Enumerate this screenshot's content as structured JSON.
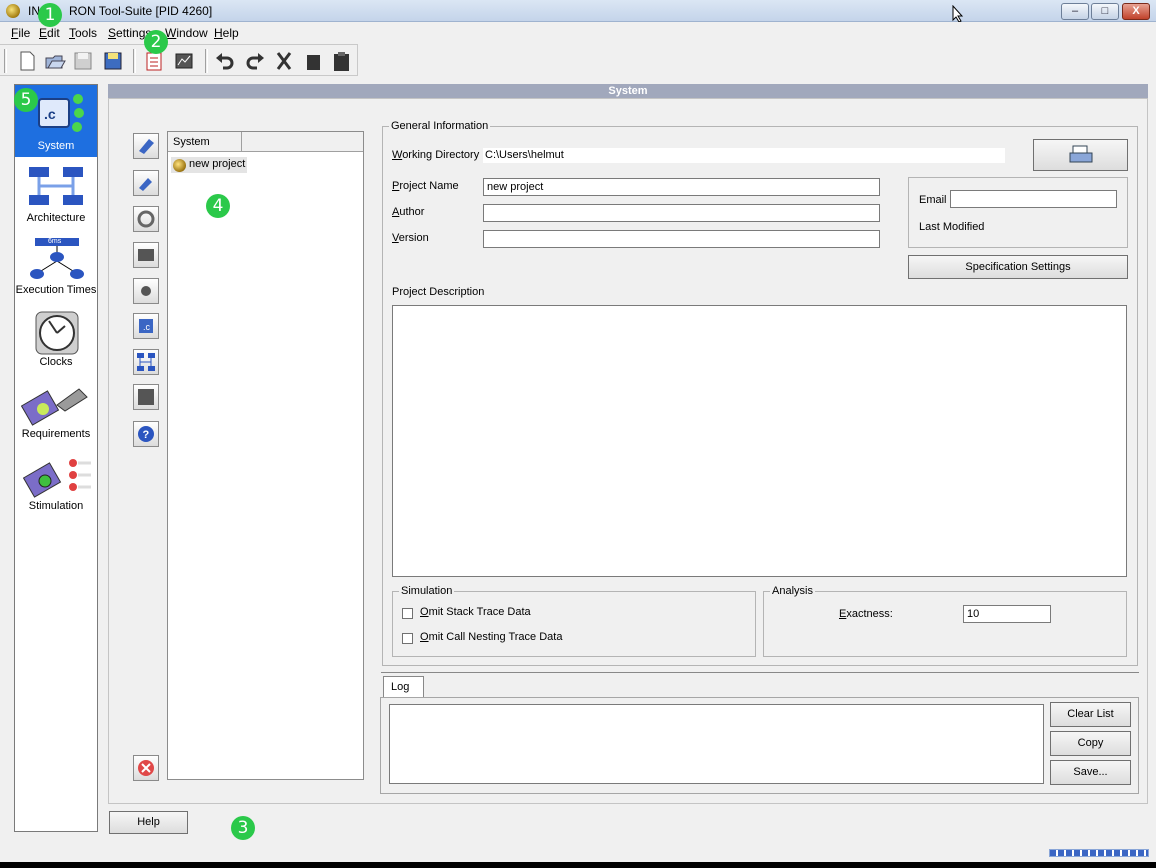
{
  "window": {
    "title": "INCHRON Tool-Suite [PID 4260]",
    "title_visible_prefix": "IN",
    "title_visible_suffix": "RON Tool-Suite [PID 4260]",
    "controls": {
      "minimize": "–",
      "maximize": "□",
      "close": "X"
    }
  },
  "menu": [
    "File",
    "Edit",
    "Tools",
    "Settings",
    "Window",
    "Help"
  ],
  "toolbar": {
    "icons": [
      "new-file-icon",
      "open-file-icon",
      "save-icon",
      "save-all-icon",
      "project-settings-icon",
      "report-icon",
      "undo-icon",
      "redo-icon",
      "cut-icon",
      "copy-icon",
      "paste-icon"
    ]
  },
  "sidebar": {
    "items": [
      {
        "label": "System",
        "icon": "system-icon",
        "selected": true
      },
      {
        "label": "Architecture",
        "icon": "architecture-icon"
      },
      {
        "label": "Execution Times",
        "icon": "execution-times-icon",
        "badge": "6ms"
      },
      {
        "label": "Clocks",
        "icon": "clock-icon"
      },
      {
        "label": "Requirements",
        "icon": "requirements-icon"
      },
      {
        "label": "Stimulation",
        "icon": "stimulation-icon"
      }
    ]
  },
  "main": {
    "header": "System"
  },
  "tree": {
    "column": "System",
    "node": "new project"
  },
  "general": {
    "legend": "General Information",
    "working_dir_label": "Working Directory",
    "working_dir": "C:\\Users\\helmut",
    "project_name_label": "Project Name",
    "project_name": "new project",
    "author_label": "Author",
    "author": "",
    "version_label": "Version",
    "version": "",
    "email_label": "Email",
    "email": "",
    "last_modified_label": "Last Modified",
    "spec_settings_label": "Specification Settings",
    "description_label": "Project Description",
    "description": ""
  },
  "simulation": {
    "legend": "Simulation",
    "omit_stack": "Omit Stack Trace Data",
    "omit_call": "Omit Call Nesting Trace Data"
  },
  "analysis": {
    "legend": "Analysis",
    "exactness_label": "Exactness:",
    "exactness": "10"
  },
  "log": {
    "tab": "Log",
    "clear": "Clear List",
    "copy": "Copy",
    "save": "Save..."
  },
  "help_button": "Help",
  "callouts": [
    "1",
    "2",
    "3",
    "4",
    "5"
  ],
  "colors": {
    "accent": "#1e6fe0",
    "callout": "#2bc94a",
    "header": "#a1a8bc"
  }
}
